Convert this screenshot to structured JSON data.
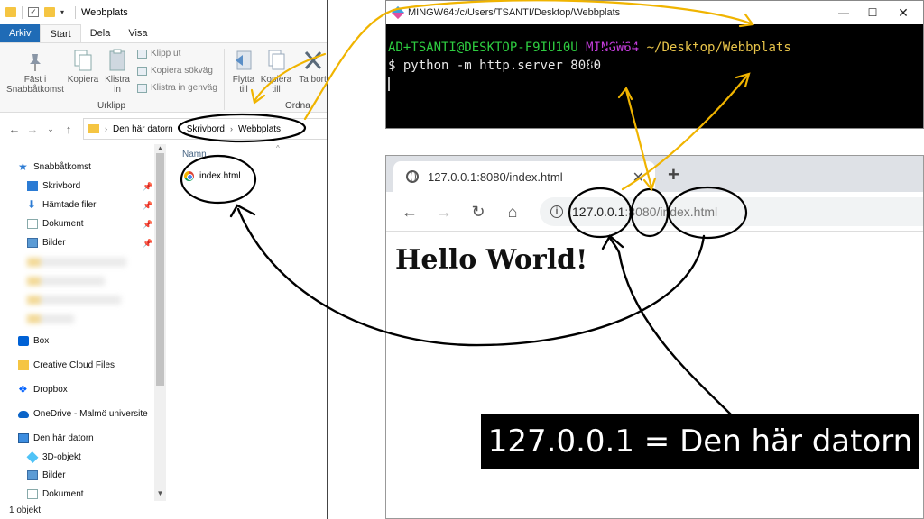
{
  "explorer": {
    "title": "Webbplats",
    "ribbon_tabs": [
      "Arkiv",
      "Start",
      "Dela",
      "Visa"
    ],
    "ribbon": {
      "pin_label": "Fäst i Snabbåtkomst",
      "copy_label": "Kopiera",
      "paste_label": "Klistra in",
      "cut_label": "Klipp ut",
      "copy_path_label": "Kopiera sökväg",
      "paste_shortcut_label": "Klistra in genväg",
      "move_label": "Flytta till",
      "copy_to_label": "Kopiera till",
      "delete_label": "Ta bort",
      "group_clipboard": "Urklipp",
      "group_organize": "Ordna"
    },
    "breadcrumb": [
      "Den här datorn",
      "Skrivbord",
      "Webbplats"
    ],
    "nav": {
      "quick_access": "Snabbåtkomst",
      "quick_items": [
        "Skrivbord",
        "Hämtade filer",
        "Dokument",
        "Bilder"
      ],
      "box": "Box",
      "creative_cloud": "Creative Cloud Files",
      "dropbox": "Dropbox",
      "onedrive": "OneDrive - Malmö universite",
      "this_pc": "Den här datorn",
      "pc_items": [
        "3D-objekt",
        "Bilder",
        "Dokument"
      ]
    },
    "column_header": "Namn",
    "files": [
      "index.html"
    ],
    "status": "1 objekt"
  },
  "terminal": {
    "title": "MINGW64:/c/Users/TSANTI/Desktop/Webbplats",
    "prompt_user": "AD+TSANTI@DESKTOP-F9IU10U",
    "prompt_env": "MINGW64",
    "prompt_path": "~/Desktop/Webbplats",
    "command": "$ python -m http.server 8080"
  },
  "browser": {
    "tab_title": "127.0.0.1:8080/index.html",
    "url_host": "127.0.0.1",
    "url_port": ":8080",
    "url_path": "/index.html",
    "heading": "Hello World!"
  },
  "caption": "127.0.0.1 = Den här datorn",
  "colors": {
    "annotation_yellow": "#f0b400",
    "annotation_black": "#000000",
    "ribbon_file_tab": "#1f6bb6",
    "terminal_green": "#2ecc40",
    "terminal_magenta": "#c13bd8",
    "terminal_yellow": "#e8c44a"
  }
}
